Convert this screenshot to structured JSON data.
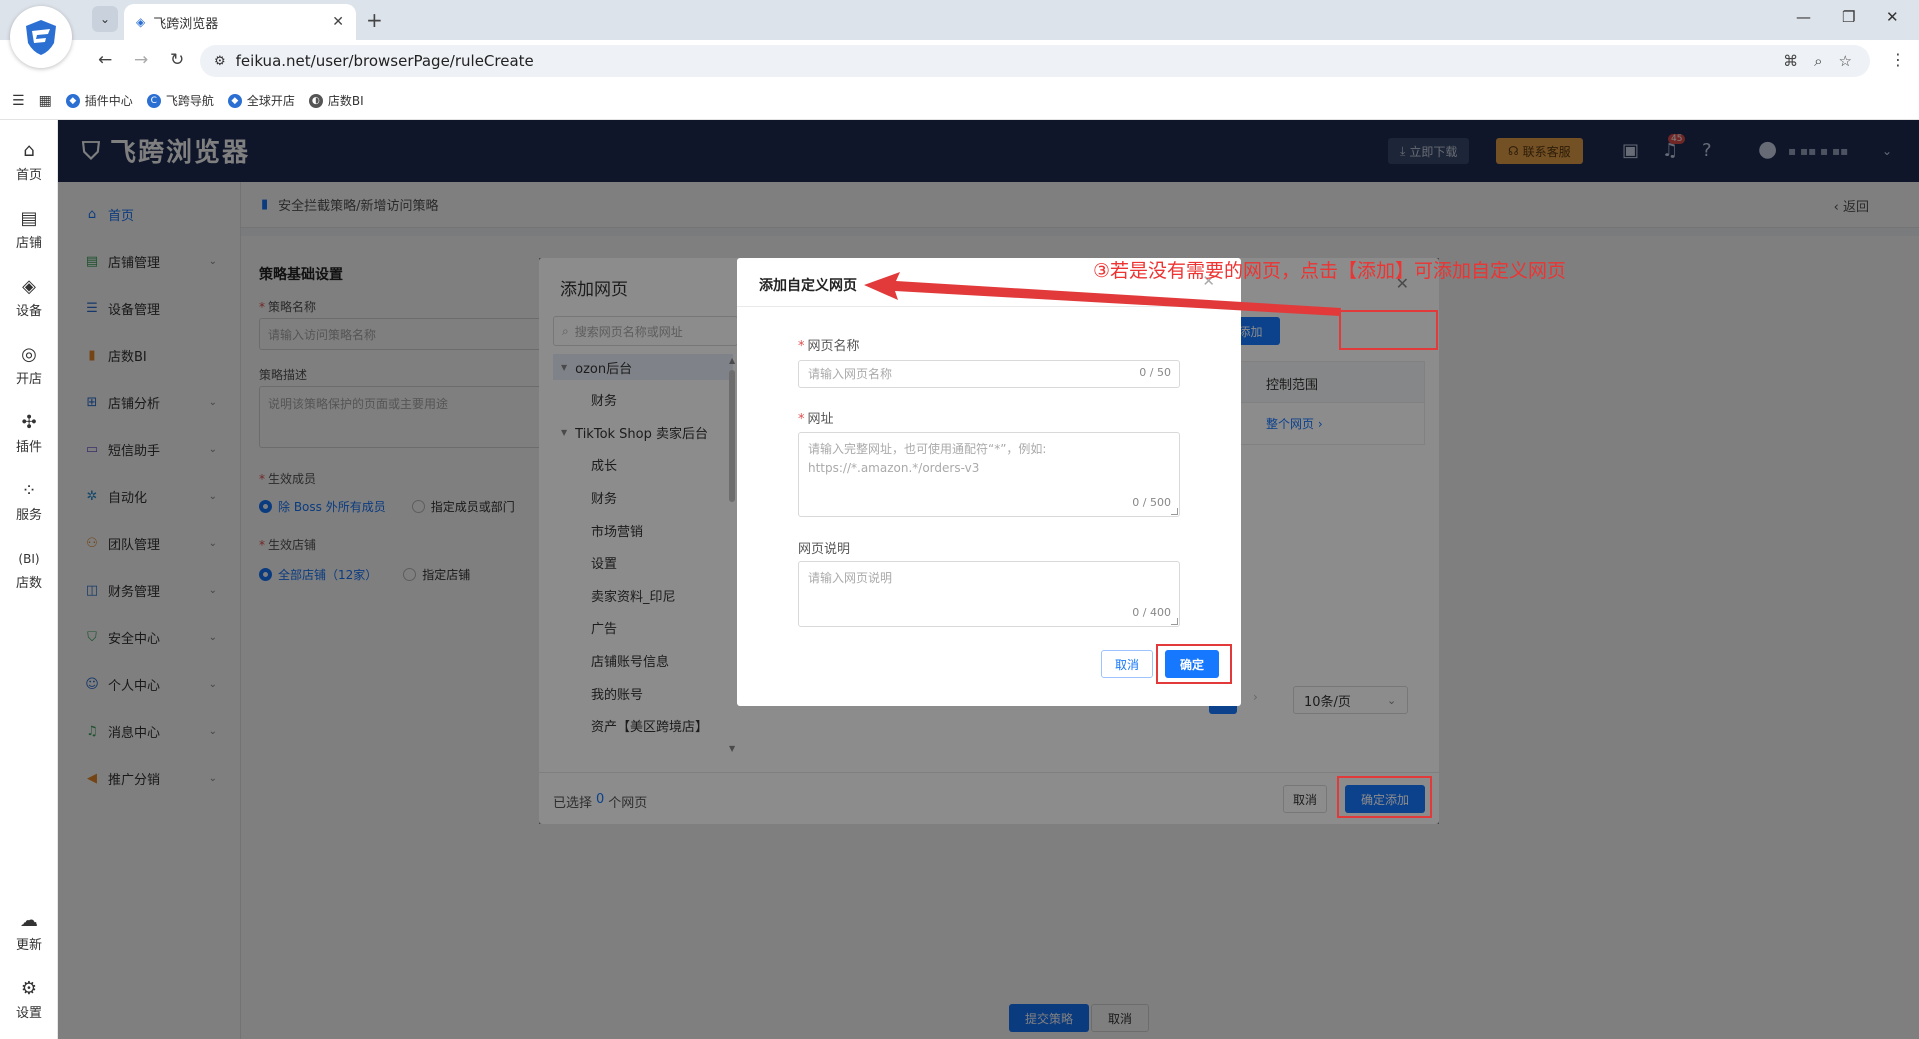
{
  "browser": {
    "tab_title": "飞跨浏览器",
    "url": "feikua.net/user/browserPage/ruleCreate",
    "bookmarks": [
      "插件中心",
      "飞跨导航",
      "全球开店",
      "店数BI"
    ]
  },
  "rail": {
    "items": [
      "首页",
      "店铺",
      "设备",
      "开店",
      "插件",
      "服务",
      "店数"
    ],
    "bottom": [
      "更新",
      "设置"
    ]
  },
  "header": {
    "brand": "飞跨浏览器",
    "download": "立即下载",
    "support": "联系客服",
    "notification_count": "45"
  },
  "menu": {
    "items": [
      "首页",
      "店铺管理",
      "设备管理",
      "店数BI",
      "店铺分析",
      "短信助手",
      "自动化",
      "团队管理",
      "财务管理",
      "安全中心",
      "个人中心",
      "消息中心",
      "推广分销"
    ]
  },
  "page": {
    "breadcrumb": "安全拦截策略/新增访问策略",
    "back": "返回",
    "section_title": "策略基础设置",
    "name_label": "策略名称",
    "name_placeholder": "请输入访问策略名称",
    "desc_label": "策略描述",
    "desc_placeholder": "说明该策略保护的页面或主要用途",
    "members_label": "生效成员",
    "members_opt1": "除 Boss 外所有成员",
    "members_opt2": "指定成员或部门",
    "shops_label": "生效店铺",
    "shops_opt1": "全部店铺（12家）",
    "shops_opt2": "指定店铺",
    "submit": "提交策略",
    "cancel": "取消"
  },
  "dialog_add": {
    "title": "添加网页",
    "search_placeholder": "搜索网页名称或网址",
    "tree": [
      {
        "label": "ozon后台",
        "level": 0,
        "selected": true
      },
      {
        "label": "财务",
        "level": 1
      },
      {
        "label": "TikTok Shop 卖家后台",
        "level": 0
      },
      {
        "label": "成长",
        "level": 1
      },
      {
        "label": "财务",
        "level": 1
      },
      {
        "label": "市场营销",
        "level": 1
      },
      {
        "label": "设置",
        "level": 1
      },
      {
        "label": "卖家资料_印尼",
        "level": 1
      },
      {
        "label": "广告",
        "level": 1
      },
      {
        "label": "店铺账号信息",
        "level": 1
      },
      {
        "label": "我的账号",
        "level": 1
      },
      {
        "label": "资产【美区跨境店】",
        "level": 1
      }
    ],
    "add_button": "添加",
    "col_scope": "控制范围",
    "row_scope": "整个网页",
    "page_size": "10条/页",
    "selected_prefix": "已选择",
    "selected_count": "0",
    "selected_suffix": "个网页",
    "cancel": "取消",
    "confirm": "确定添加"
  },
  "dialog_custom": {
    "title": "添加自定义网页",
    "name_label": "网页名称",
    "name_placeholder": "请输入网页名称",
    "name_count": "0 / 50",
    "url_label": "网址",
    "url_placeholder": "请输入完整网址，也可使用通配符“*”，例如: https://*.amazon.*/orders-v3",
    "url_count": "0 / 500",
    "desc_label": "网页说明",
    "desc_placeholder": "请输入网页说明",
    "desc_count": "0 / 400",
    "cancel": "取消",
    "confirm": "确定"
  },
  "annotation": {
    "text": "③若是没有需要的网页，点击【添加】可添加自定义网页",
    "color": "#e23a3a"
  },
  "colors": {
    "primary": "#1677ff",
    "header_bg": "#1e2d54"
  }
}
